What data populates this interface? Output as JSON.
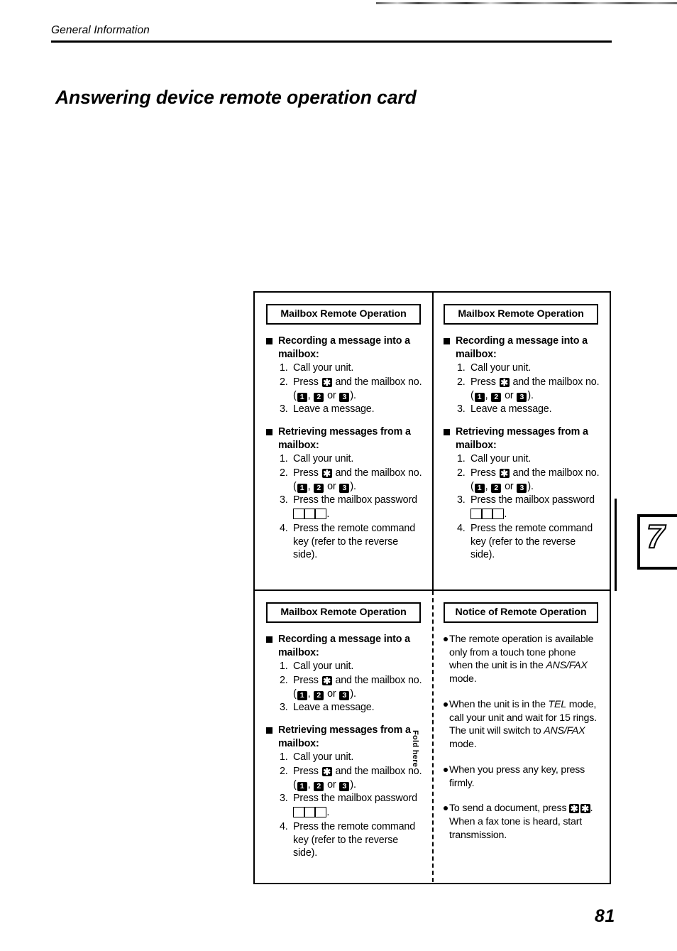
{
  "header": {
    "section_label": "General Information"
  },
  "page_title": "Answering device remote operation card",
  "folio": "81",
  "chapter_tab": {
    "number": "7"
  },
  "fold_label": "Fold here",
  "keys": {
    "star": "✱",
    "one": "1",
    "two": "2",
    "three": "3"
  },
  "mailbox_card": {
    "title": "Mailbox Remote Operation",
    "sections": [
      {
        "heading": "Recording a message into a mailbox:",
        "steps": [
          {
            "num": "1.",
            "text_before": "Call your unit.",
            "keys": [],
            "text_after": ""
          },
          {
            "num": "2.",
            "text_before": "Press",
            "text_mid": "and the mailbox no.",
            "text_after": ""
          },
          {
            "num": "3.",
            "text_before": "Leave a message.",
            "keys": [],
            "text_after": ""
          }
        ]
      },
      {
        "heading": "Retrieving messages from a mailbox:",
        "steps": [
          {
            "num": "1.",
            "text_before": "Call your unit."
          },
          {
            "num": "2.",
            "text_before": "Press",
            "text_mid": "and the mailbox no."
          },
          {
            "num": "3.",
            "text_before": "Press the mailbox password"
          },
          {
            "num": "4.",
            "text_before": "Press the remote command key (refer to the reverse side)."
          }
        ]
      }
    ],
    "press_label": "Press",
    "and_mailbox_no": "and the mailbox no.",
    "paren_open": "(",
    "comma": ",",
    "or_label": "or",
    "paren_close": ").",
    "password_period": "."
  },
  "notice_card": {
    "title": "Notice of Remote Operation",
    "items": [
      {
        "part1": "The remote operation is available only from a touch tone phone when the unit is in the ",
        "emphasis": "ANS/FAX",
        "part2": " mode."
      },
      {
        "part1": "When the unit is in the ",
        "emphasis": "TEL",
        "part2": " mode, call your unit and wait for 15 rings. The unit will switch to ",
        "emphasis2": "ANS/FAX",
        "part3": " mode."
      },
      {
        "part1": "When you press any key, press firmly.",
        "emphasis": "",
        "part2": ""
      },
      {
        "part1": "To send a document, press ",
        "emphasis": "",
        "part2": ". When a fax tone is heard, start transmission."
      }
    ]
  }
}
